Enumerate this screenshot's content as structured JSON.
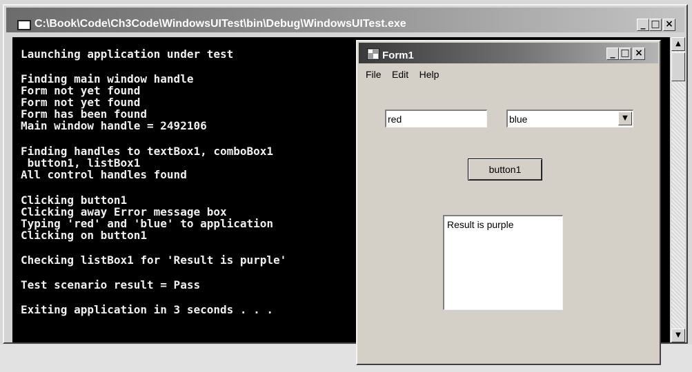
{
  "console": {
    "title": "C:\\Book\\Code\\Ch3Code\\WindowsUITest\\bin\\Debug\\WindowsUITest.exe",
    "buttons": {
      "minimize": "_",
      "maximize": "□",
      "close": "×"
    },
    "lines": [
      "Launching application under test",
      "Finding main window handle",
      "Form not yet found",
      "Form not yet found",
      "Form has been found",
      "Main window handle = 2492106",
      "Finding handles to textBox1, comboBox1",
      " button1, listBox1",
      "All control handles found",
      "Clicking button1",
      "Clicking away Error message box",
      "Typing 'red' and 'blue' to application",
      "Clicking on button1",
      "Checking listBox1 for 'Result is purple'",
      "Test scenario result = Pass",
      "Exiting application in 3 seconds . . ."
    ],
    "scrollbar": {
      "up": "▲",
      "down": "▼"
    }
  },
  "form": {
    "title": "Form1",
    "buttons": {
      "minimize": "_",
      "maximize": "□",
      "close": "×"
    },
    "menu": [
      "File",
      "Edit",
      "Help"
    ],
    "textbox_value": "red",
    "combo_value": "blue",
    "combo_arrow": "▼",
    "button_label": "button1",
    "list_items": [
      "Result is purple"
    ]
  }
}
